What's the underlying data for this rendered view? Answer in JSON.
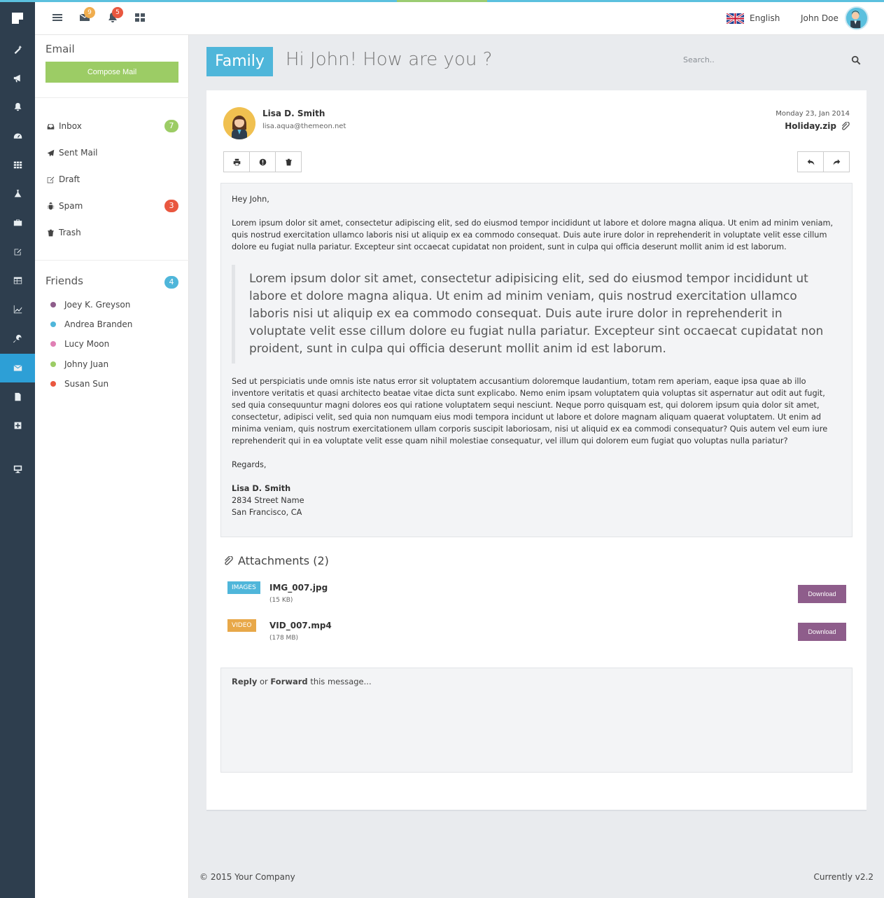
{
  "app": {
    "colors": {
      "accent": "#5bc0de",
      "iconbar_bg": "#2e3e4e",
      "active_nav": "#2d9fd6",
      "compose": "#9ccc65",
      "download": "#8e5d8b",
      "badge_orange": "#f0ad4e",
      "badge_red": "#e9573f"
    }
  },
  "iconbar": {
    "items": [
      {
        "icon": "magic-wand-icon"
      },
      {
        "icon": "megaphone-icon"
      },
      {
        "icon": "bell-icon"
      },
      {
        "icon": "dashboard-icon"
      },
      {
        "icon": "grid-icon"
      },
      {
        "icon": "flask-icon"
      },
      {
        "icon": "briefcase-icon"
      },
      {
        "icon": "edit-icon"
      },
      {
        "icon": "table-icon"
      },
      {
        "icon": "chart-icon"
      },
      {
        "icon": "wrench-icon"
      },
      {
        "icon": "envelope-icon",
        "active": true
      },
      {
        "icon": "file-icon"
      },
      {
        "icon": "plus-square-icon"
      },
      {
        "icon": "desktop-icon"
      }
    ]
  },
  "header": {
    "mail_badge": "9",
    "notifications_badge": "5",
    "language": "English",
    "user_name": "John Doe"
  },
  "mail_sidebar": {
    "title": "Email",
    "compose_label": "Compose Mail",
    "folders": [
      {
        "label": "Inbox",
        "count": "7",
        "icon": "inbox-icon"
      },
      {
        "label": "Sent Mail",
        "count": "",
        "icon": "paper-plane-icon"
      },
      {
        "label": "Draft",
        "count": "",
        "icon": "edit-icon"
      },
      {
        "label": "Spam",
        "count": "3",
        "icon": "bug-icon"
      },
      {
        "label": "Trash",
        "count": "",
        "icon": "trash-icon"
      }
    ],
    "friends_title": "Friends",
    "friends_count": "4",
    "friends": [
      {
        "name": "Joey K. Greyson",
        "color": "#8e5d8b"
      },
      {
        "name": "Andrea Branden",
        "color": "#4fb6da"
      },
      {
        "name": "Lucy Moon",
        "color": "#e07fb4"
      },
      {
        "name": "Johny Juan",
        "color": "#9ccc65"
      },
      {
        "name": "Susan Sun",
        "color": "#e9573f"
      }
    ]
  },
  "main": {
    "tag": "Family",
    "subject": "Hi John! How are you ?",
    "search_placeholder": "Search.."
  },
  "message": {
    "sender_name": "Lisa D. Smith",
    "sender_email": "lisa.aqua@themeon.net",
    "date": "Monday 23, Jan 2014",
    "attachment_file": "Holiday.zip",
    "greeting": "Hey John,",
    "para1": "Lorem ipsum dolor sit amet, consectetur adipiscing elit, sed do eiusmod tempor incididunt ut labore et dolore magna aliqua. Ut enim ad minim veniam, quis nostrud exercitation ullamco laboris nisi ut aliquip ex ea commodo consequat. Duis aute irure dolor in reprehenderit in voluptate velit esse cillum dolore eu fugiat nulla pariatur. Excepteur sint occaecat cupidatat non proident, sunt in culpa qui officia deserunt mollit anim id est laborum.",
    "quote": "Lorem ipsum dolor sit amet, consectetur adipisicing elit, sed do eiusmod tempor incididunt ut labore et dolore magna aliqua. Ut enim ad minim veniam, quis nostrud exercitation ullamco laboris nisi ut aliquip ex ea commodo consequat. Duis aute irure dolor in reprehenderit in voluptate velit esse cillum dolore eu fugiat nulla pariatur. Excepteur sint occaecat cupidatat non proident, sunt in culpa qui officia deserunt mollit anim id est laborum.",
    "para2": "Sed ut perspiciatis unde omnis iste natus error sit voluptatem accusantium doloremque laudantium, totam rem aperiam, eaque ipsa quae ab illo inventore veritatis et quasi architecto beatae vitae dicta sunt explicabo. Nemo enim ipsam voluptatem quia voluptas sit aspernatur aut odit aut fugit, sed quia consequuntur magni dolores eos qui ratione voluptatem sequi nesciunt. Neque porro quisquam est, qui dolorem ipsum quia dolor sit amet, consectetur, adipisci velit, sed quia non numquam eius modi tempora incidunt ut labore et dolore magnam aliquam quaerat voluptatem. Ut enim ad minima veniam, quis nostrum exercitationem ullam corporis suscipit laboriosam, nisi ut aliquid ex ea commodi consequatur? Quis autem vel eum iure reprehenderit qui in ea voluptate velit esse quam nihil molestiae consequatur, vel illum qui dolorem eum fugiat quo voluptas nulla pariatur?",
    "regards": "Regards,",
    "signature_name": "Lisa D. Smith",
    "signature_street": "2834 Street Name",
    "signature_city": "San Francisco, CA"
  },
  "attachments": {
    "title": "Attachments (2)",
    "items": [
      {
        "label": "IMAGES",
        "label_color": "#4fb6da",
        "file": "IMG_007.jpg",
        "size": "(15 KB)",
        "button": "Download"
      },
      {
        "label": "VIDEO",
        "label_color": "#e8a849",
        "file": "VID_007.mp4",
        "size": "(178 MB)",
        "button": "Download"
      }
    ]
  },
  "reply": {
    "reply_word": "Reply",
    "or_word": "or",
    "forward_word": "Forward",
    "rest": "this message..."
  },
  "footer": {
    "copyright": "© 2015 Your Company",
    "version": "Currently v2.2"
  }
}
